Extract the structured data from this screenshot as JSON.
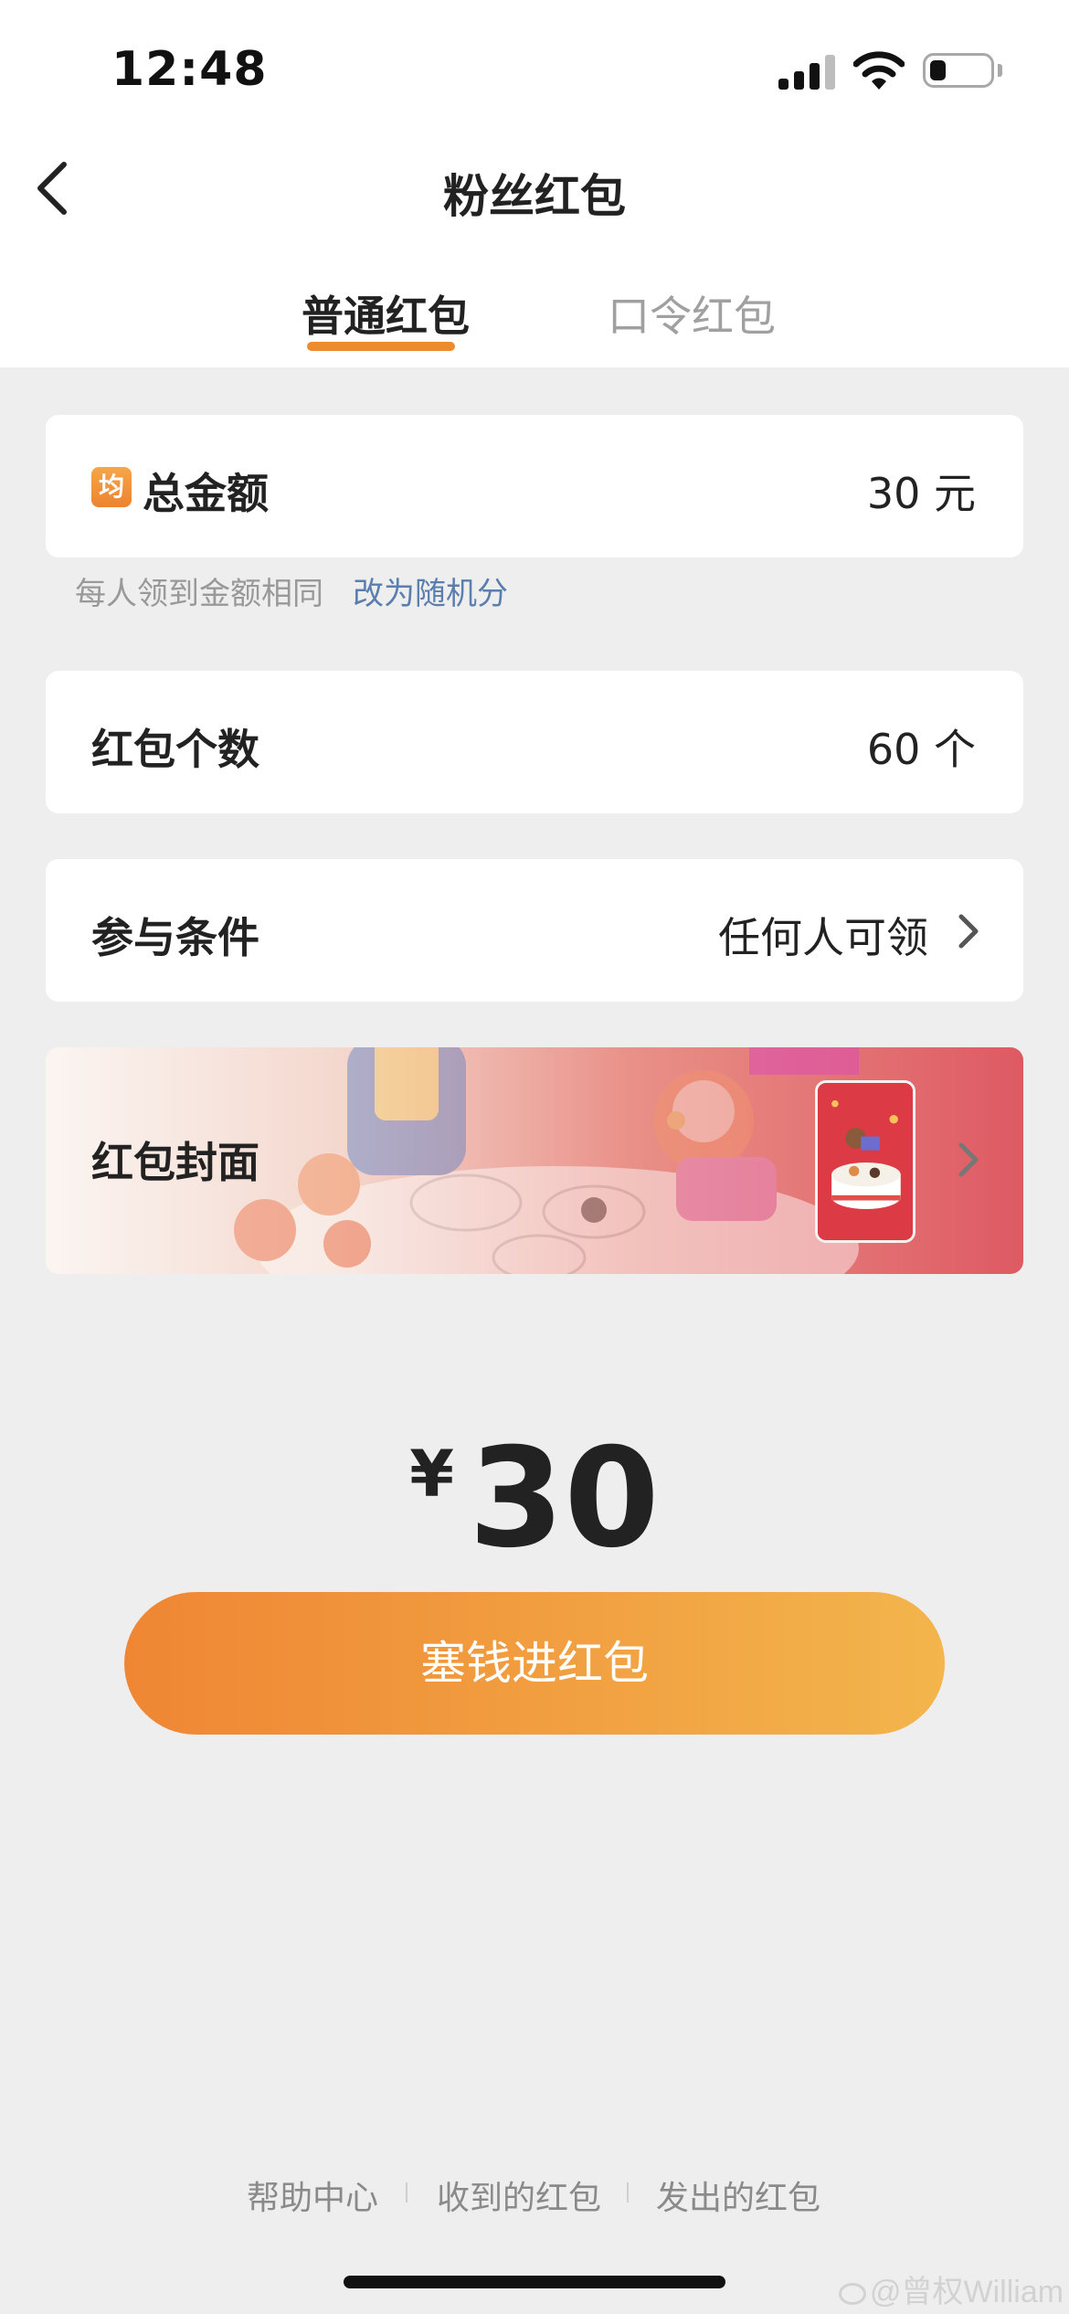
{
  "status_bar": {
    "time": "12:48",
    "signal_icon": "cellular-signal-icon",
    "wifi_icon": "wifi-icon",
    "battery_icon": "battery-icon",
    "battery_level": 0.25
  },
  "nav": {
    "title": "粉丝红包",
    "back_icon": "back-arrow-icon"
  },
  "tabs": [
    {
      "label": "普通红包",
      "active": true
    },
    {
      "label": "口令红包",
      "active": false
    }
  ],
  "total_amount": {
    "badge": "均",
    "label": "总金额",
    "value": "30 元"
  },
  "split_hint": {
    "text": "每人领到金额相同",
    "link": "改为随机分"
  },
  "packet_count": {
    "label": "红包个数",
    "value": "60 个"
  },
  "conditions": {
    "label": "参与条件",
    "value": "任何人可领",
    "chevron_icon": "chevron-right-icon"
  },
  "cover": {
    "label": "红包封面",
    "thumbnail": "red-packet-cover-thumbnail",
    "chevron_icon": "chevron-right-icon"
  },
  "amount": {
    "currency": "¥",
    "value": "30"
  },
  "submit_button": {
    "label": "塞钱进红包"
  },
  "footer": {
    "links": [
      "帮助中心",
      "收到的红包",
      "发出的红包"
    ]
  },
  "watermark": {
    "text": "@曾权William"
  },
  "colors": {
    "accent": "#ed8b2f",
    "link": "#5a7fae",
    "background": "#eeeeee"
  }
}
